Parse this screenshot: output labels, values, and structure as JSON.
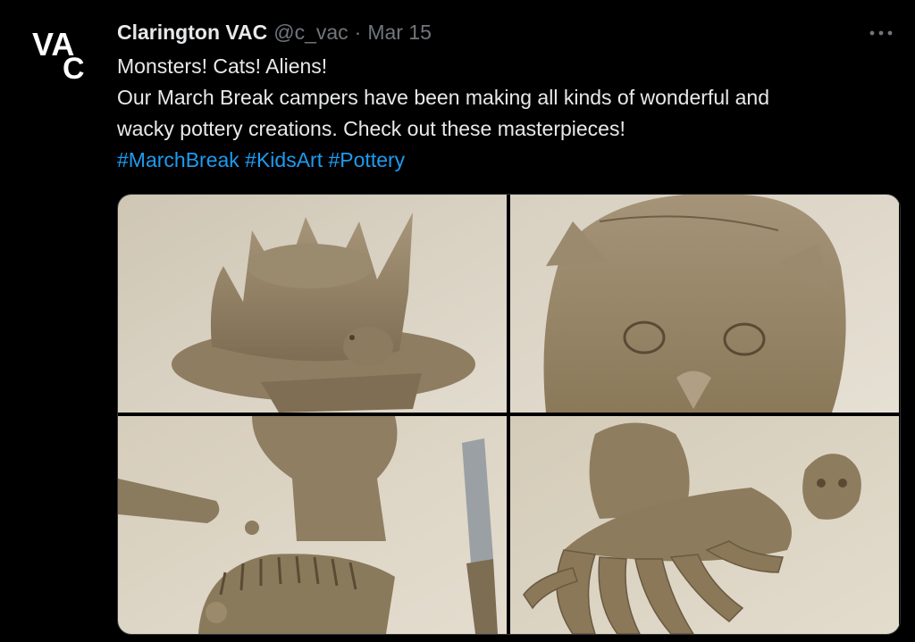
{
  "account": {
    "display_name": "Clarington VAC",
    "handle": "@c_vac",
    "separator": "·",
    "date": "Mar 15",
    "avatar_text": {
      "line1": "VA",
      "line2": "C"
    }
  },
  "tweet": {
    "line1": "Monsters! Cats! Aliens!",
    "line2": "Our March Break campers have been making all kinds of wonderful and",
    "line3": "wacky pottery creations. Check out these masterpieces!",
    "hashtags": [
      "#MarchBreak",
      "#KidsArt",
      "#Pottery"
    ]
  },
  "more_icon": "more-horizontal-icon",
  "colors": {
    "background": "#000000",
    "text": "#e7e9ea",
    "muted": "#71767b",
    "link": "#1d9bf0",
    "clay": "#9c8a6b",
    "table": "#d9d2c4"
  },
  "media": {
    "photos": [
      {
        "subject": "clay flower monster sculpture"
      },
      {
        "subject": "clay cat face"
      },
      {
        "subject": "clay figure with tool"
      },
      {
        "subject": "clay alien creature with tentacles"
      }
    ]
  }
}
